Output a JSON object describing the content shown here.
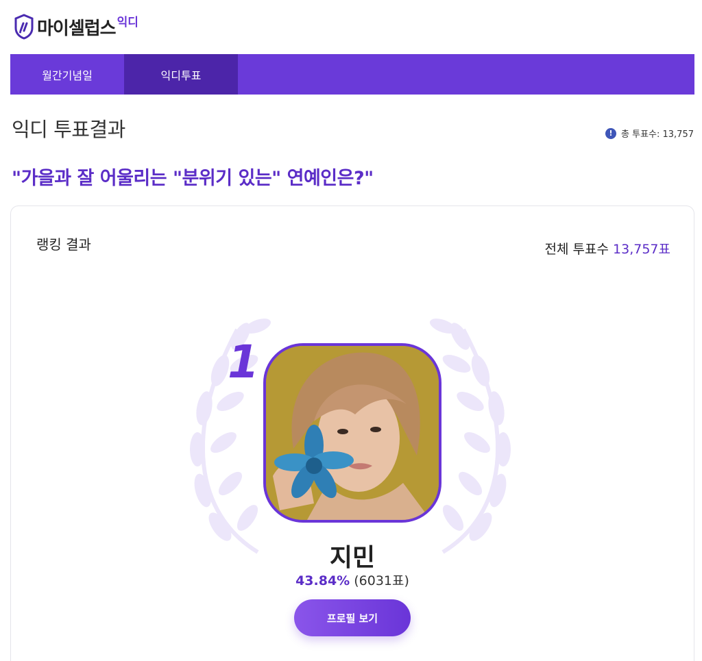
{
  "header": {
    "logo_main": "마이셀럽스",
    "logo_sub": "익디",
    "logo_icon": "brand-shield-icon"
  },
  "nav": {
    "tabs": [
      {
        "label": "월간기념일",
        "active": false
      },
      {
        "label": "익디투표",
        "active": true
      }
    ]
  },
  "page": {
    "title": "익디 투표결과",
    "total_summary": "총 투표수: 13,757",
    "question": "\"가을과 잘 어울리는 \"분위기 있는\" 연예인은?\""
  },
  "result_card": {
    "label": "랭킹 결과",
    "total_label": "전체 투표수",
    "total_value": "13,757표",
    "winner": {
      "rank": "1",
      "name": "지민",
      "percent": "43.84%",
      "votes": "(6031표)",
      "profile_button": "프로필 보기"
    }
  },
  "colors": {
    "accent": "#6a3ad9",
    "accent_dark": "#4c25a9",
    "question_text": "#5b2dc7",
    "info_icon": "#3f56b8"
  }
}
